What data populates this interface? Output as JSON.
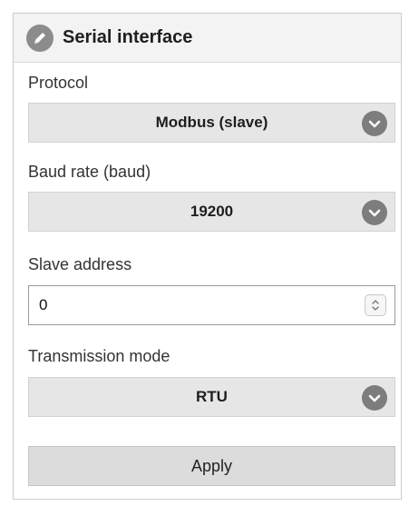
{
  "panel": {
    "title": "Serial interface",
    "icon": "edit-icon"
  },
  "protocol": {
    "label": "Protocol",
    "value": "Modbus (slave)"
  },
  "baud_rate": {
    "label": "Baud rate (baud)",
    "value": "19200"
  },
  "slave_address": {
    "label": "Slave address",
    "value": "0"
  },
  "transmission_mode": {
    "label": "Transmission mode",
    "value": "RTU"
  },
  "apply": {
    "label": "Apply"
  },
  "colors": {
    "header_bg": "#f3f3f3",
    "select_bg": "#e6e6e6",
    "chevron_bg": "#7d7d7d",
    "button_bg": "#dcdcdc"
  }
}
